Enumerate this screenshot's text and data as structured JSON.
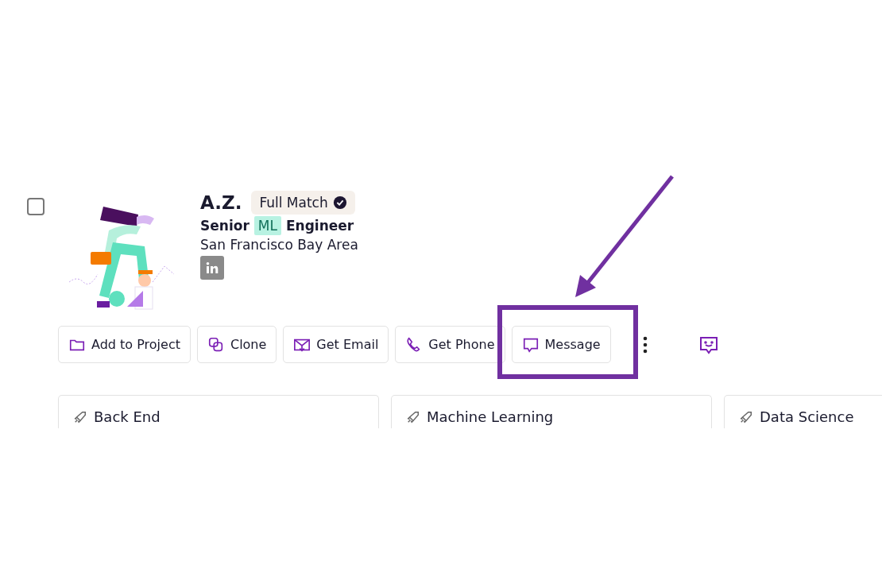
{
  "candidate": {
    "checked": false,
    "name": "A.Z.",
    "badge": "Full Match",
    "title": [
      {
        "text": "Senior",
        "highlighted": false
      },
      {
        "text": "ML",
        "highlighted": true
      },
      {
        "text": "Engineer",
        "highlighted": false
      }
    ],
    "location": "San Francisco Bay Area"
  },
  "actions": [
    {
      "label": "Add to Project",
      "kind": "folder",
      "annotated": false
    },
    {
      "label": "Clone",
      "kind": "clone",
      "annotated": false
    },
    {
      "label": "Get Email",
      "kind": "email",
      "annotated": false
    },
    {
      "label": "Get Phone",
      "kind": "phone",
      "annotated": false
    },
    {
      "label": "Message",
      "kind": "message",
      "annotated": true
    }
  ],
  "skills": [
    "Back End",
    "Machine Learning",
    "Data Science"
  ]
}
